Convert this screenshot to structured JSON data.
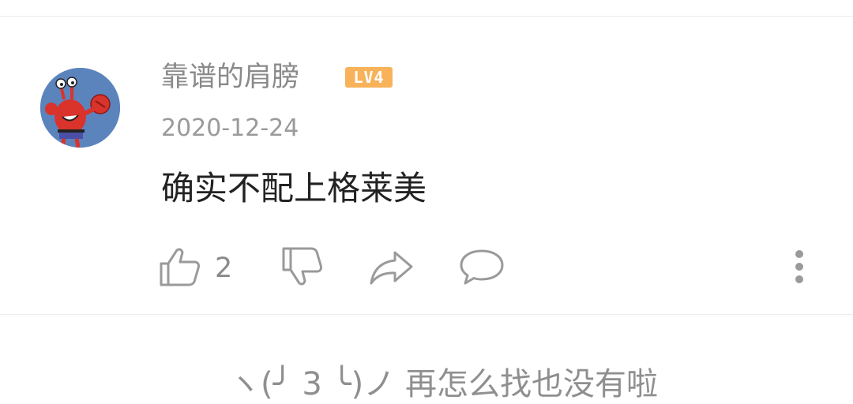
{
  "comment": {
    "username": "靠谱的肩膀",
    "level_badge": "LV4",
    "date": "2020-12-24",
    "text": "确实不配上格莱美",
    "like_count": "2",
    "avatar_icon": "cartoon-crab-avatar"
  },
  "footer": {
    "end_text": "ヽ(╯ 3 ╰)ノ 再怎么找也没有啦"
  },
  "colors": {
    "badge": "#f8b25a",
    "avatar_bg": "#5b84bd",
    "icon_gray": "#9a9a9a"
  }
}
